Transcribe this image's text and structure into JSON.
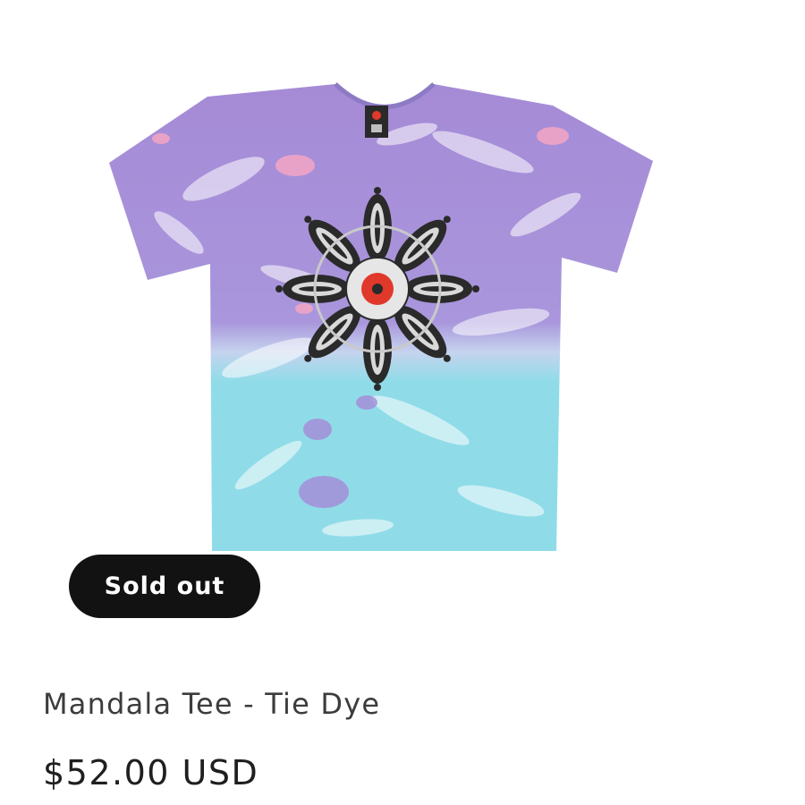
{
  "product": {
    "image_alt": "Mandala Tee - Tie Dye",
    "badge_label": "Sold out",
    "title": "Mandala Tee - Tie Dye",
    "price": "$52.00 USD"
  },
  "colors": {
    "badge_bg": "#121212",
    "badge_text": "#ffffff",
    "tie_dye_purple": "#a58ad6",
    "tie_dye_blue": "#8fdce8",
    "tie_dye_pink": "#f3a6c6",
    "mandala_dark": "#2a2a2a",
    "mandala_center": "#e0392b"
  }
}
